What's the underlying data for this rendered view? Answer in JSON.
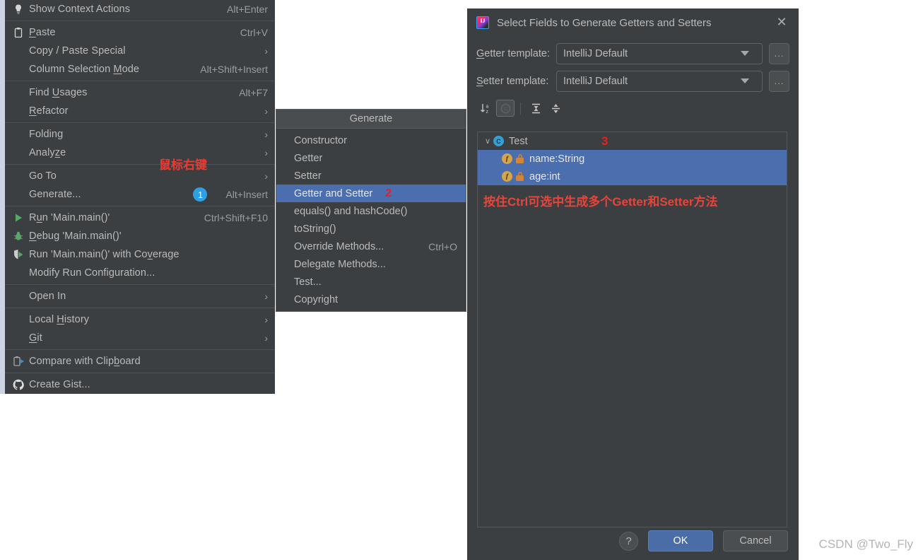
{
  "colors": {
    "menu_bg": "#3c3f41",
    "selection_blue": "#4b6eaf",
    "annotation_red": "#f01d1d",
    "badge_blue": "#2f9fe3",
    "ok_button": "#4a6da7"
  },
  "context_menu": {
    "annotation": "鼠标右键",
    "groups": [
      {
        "items": [
          {
            "icon": "lightbulb-icon",
            "label": "Show Context Actions",
            "accel": "Alt+Enter",
            "arrow": "",
            "underline": ""
          }
        ]
      },
      {
        "items": [
          {
            "icon": "clipboard-icon",
            "label": "Paste",
            "accel": "Ctrl+V",
            "arrow": "",
            "underline": "P"
          },
          {
            "icon": "",
            "label": "Copy / Paste Special",
            "accel": "",
            "arrow": "›",
            "underline": ""
          },
          {
            "icon": "",
            "label": "Column Selection Mode",
            "accel": "Alt+Shift+Insert",
            "arrow": "",
            "underline": "M"
          }
        ]
      },
      {
        "items": [
          {
            "icon": "",
            "label": "Find Usages",
            "accel": "Alt+F7",
            "arrow": "",
            "underline": "U"
          },
          {
            "icon": "",
            "label": "Refactor",
            "accel": "",
            "arrow": "›",
            "underline": "R"
          }
        ]
      },
      {
        "items": [
          {
            "icon": "",
            "label": "Folding",
            "accel": "",
            "arrow": "›",
            "underline": ""
          },
          {
            "icon": "",
            "label": "Analyze",
            "accel": "",
            "arrow": "›",
            "underline": "z"
          }
        ]
      },
      {
        "items": [
          {
            "icon": "",
            "label": "Go To",
            "accel": "",
            "arrow": "›",
            "underline": ""
          },
          {
            "icon": "",
            "label": "Generate...",
            "accel": "Alt+Insert",
            "arrow": "",
            "underline": "",
            "badge": "1"
          }
        ]
      },
      {
        "items": [
          {
            "icon": "run-icon",
            "label": "Run 'Main.main()'",
            "accel": "Ctrl+Shift+F10",
            "arrow": "",
            "underline": "u"
          },
          {
            "icon": "debug-icon",
            "label": "Debug 'Main.main()'",
            "accel": "",
            "arrow": "",
            "underline": "D"
          },
          {
            "icon": "coverage-icon",
            "label": "Run 'Main.main()' with Coverage",
            "accel": "",
            "arrow": "",
            "underline": "v"
          },
          {
            "icon": "",
            "label": "Modify Run Configuration...",
            "accel": "",
            "arrow": "",
            "underline": ""
          }
        ]
      },
      {
        "items": [
          {
            "icon": "",
            "label": "Open In",
            "accel": "",
            "arrow": "›",
            "underline": ""
          }
        ]
      },
      {
        "items": [
          {
            "icon": "",
            "label": "Local History",
            "accel": "",
            "arrow": "›",
            "underline": "H"
          },
          {
            "icon": "",
            "label": "Git",
            "accel": "",
            "arrow": "›",
            "underline": "G"
          }
        ]
      },
      {
        "items": [
          {
            "icon": "compare-clipboard-icon",
            "label": "Compare with Clipboard",
            "accel": "",
            "arrow": "",
            "underline": "b"
          }
        ]
      },
      {
        "items": [
          {
            "icon": "github-icon",
            "label": "Create Gist...",
            "accel": "",
            "arrow": "",
            "underline": ""
          }
        ]
      }
    ]
  },
  "generate_popup": {
    "title": "Generate",
    "annotation": "2",
    "items": [
      {
        "label": "Constructor",
        "accel": "",
        "selected": false
      },
      {
        "label": "Getter",
        "accel": "",
        "selected": false
      },
      {
        "label": "Setter",
        "accel": "",
        "selected": false
      },
      {
        "label": "Getter and Setter",
        "accel": "",
        "selected": true
      },
      {
        "label": "equals() and hashCode()",
        "accel": "",
        "selected": false
      },
      {
        "label": "toString()",
        "accel": "",
        "selected": false
      },
      {
        "label": "Override Methods...",
        "accel": "Ctrl+O",
        "selected": false
      },
      {
        "label": "Delegate Methods...",
        "accel": "",
        "selected": false
      },
      {
        "label": "Test...",
        "accel": "",
        "selected": false
      },
      {
        "label": "Copyright",
        "accel": "",
        "selected": false
      }
    ]
  },
  "dialog": {
    "title": "Select Fields to Generate Getters and Setters",
    "close_label": "✕",
    "getter_template": {
      "label": "Getter template:",
      "underline": "G",
      "value": "IntelliJ Default",
      "ellipsis": "..."
    },
    "setter_template": {
      "label": "Setter template:",
      "underline": "S",
      "value": "IntelliJ Default",
      "ellipsis": "..."
    },
    "toolbar": [
      {
        "name": "sort-alphabetically-icon",
        "active": false
      },
      {
        "name": "show-class-icon",
        "active": true
      },
      {
        "name": "expand-all-icon",
        "active": false
      },
      {
        "name": "collapse-all-icon",
        "active": false
      }
    ],
    "tree": {
      "annotation_number": "3",
      "annotation_text": "按住Ctrl可选中生成多个Getter和Setter方法",
      "root": {
        "label": "Test",
        "icon": "class-icon",
        "expanded": true,
        "chevron": "∨"
      },
      "children": [
        {
          "label": "name:String",
          "icon": "field-icon",
          "modifier_icon": "private-lock-icon",
          "selected": true
        },
        {
          "label": "age:int",
          "icon": "field-icon",
          "modifier_icon": "private-lock-icon",
          "selected": true
        }
      ]
    },
    "buttons": {
      "help": "?",
      "ok": "OK",
      "cancel": "Cancel"
    }
  },
  "watermark": "CSDN @Two_Fly"
}
